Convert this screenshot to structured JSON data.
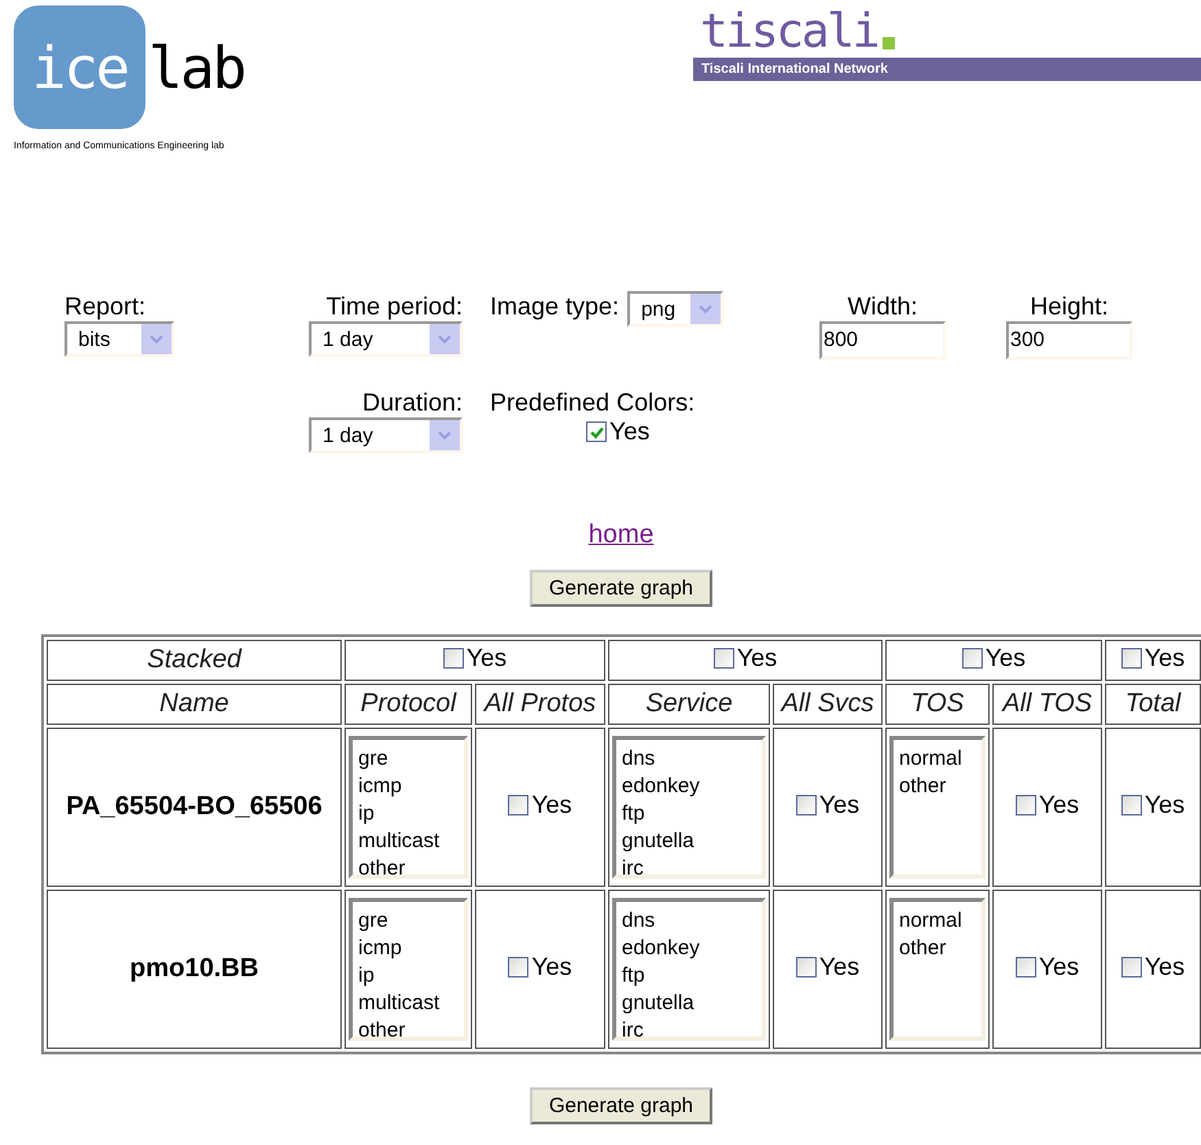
{
  "logos": {
    "icelab": {
      "part_1": "ice",
      "part_2": "lab",
      "caption": "Information and Communications Engineering lab"
    },
    "tiscali": {
      "name": "tiscali",
      "tagline": "Tiscali International Network"
    }
  },
  "form": {
    "report": {
      "label": "Report:",
      "value": "bits"
    },
    "time_period": {
      "label": "Time period:",
      "value": "1 day"
    },
    "image_type": {
      "label": "Image type:",
      "value": "png"
    },
    "width": {
      "label": "Width:",
      "value": "800"
    },
    "height": {
      "label": "Height:",
      "value": "300"
    },
    "duration": {
      "label": "Duration:",
      "value": "1 day"
    },
    "predefined_colors": {
      "label": "Predefined Colors:",
      "option": "Yes",
      "checked": true
    }
  },
  "home_link": "home",
  "generate_buttons": [
    "Generate graph",
    "Generate graph"
  ],
  "table": {
    "stacked_label": "Stacked",
    "stacked": [
      {
        "label": "Yes",
        "checked": false
      },
      {
        "label": "Yes",
        "checked": false
      },
      {
        "label": "Yes",
        "checked": false
      },
      {
        "label": "Yes",
        "checked": false
      }
    ],
    "columns": [
      "Name",
      "Protocol",
      "All Protos",
      "Service",
      "All Svcs",
      "TOS",
      "All TOS",
      "Total"
    ],
    "rows": [
      {
        "name": "PA_65504-BO_65506",
        "protocols": [
          "gre",
          "icmp",
          "ip",
          "multicast",
          "other"
        ],
        "all_protos": {
          "label": "Yes",
          "checked": false
        },
        "services": [
          "dns",
          "edonkey",
          "ftp",
          "gnutella",
          "irc"
        ],
        "all_svcs": {
          "label": "Yes",
          "checked": false
        },
        "tos": [
          "normal",
          "other"
        ],
        "all_tos": {
          "label": "Yes",
          "checked": false
        },
        "total": {
          "label": "Yes",
          "checked": false
        }
      },
      {
        "name": "pmo10.BB",
        "protocols": [
          "gre",
          "icmp",
          "ip",
          "multicast",
          "other"
        ],
        "all_protos": {
          "label": "Yes",
          "checked": false
        },
        "services": [
          "dns",
          "edonkey",
          "ftp",
          "gnutella",
          "irc"
        ],
        "all_svcs": {
          "label": "Yes",
          "checked": false
        },
        "tos": [
          "normal",
          "other"
        ],
        "all_tos": {
          "label": "Yes",
          "checked": false
        },
        "total": {
          "label": "Yes",
          "checked": false
        }
      }
    ]
  }
}
